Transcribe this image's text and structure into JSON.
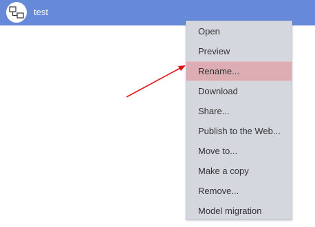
{
  "header": {
    "title": "test",
    "icon": "diagram-icon",
    "background": "#6689da"
  },
  "context_menu": {
    "items": [
      {
        "label": "Open"
      },
      {
        "label": "Preview"
      },
      {
        "label": "Rename...",
        "highlighted": true
      },
      {
        "label": "Download"
      },
      {
        "label": "Share..."
      },
      {
        "label": "Publish to the Web..."
      },
      {
        "label": "Move to..."
      },
      {
        "label": "Make a copy"
      },
      {
        "label": "Remove..."
      },
      {
        "label": "Model migration"
      }
    ],
    "highlight_color": "#ddadb4",
    "background": "#d4d7dd"
  },
  "annotation": {
    "type": "arrow",
    "color": "#e0100f",
    "points_to": "Rename..."
  }
}
